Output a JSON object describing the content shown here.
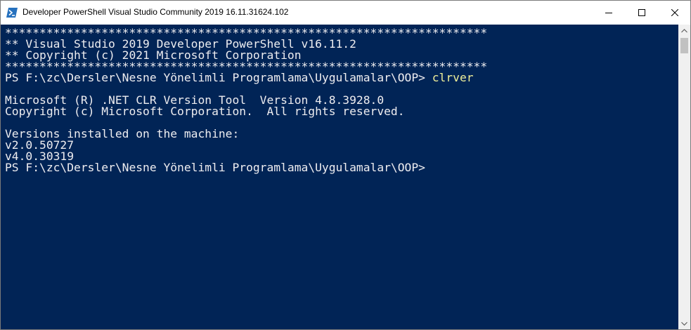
{
  "window": {
    "title": "Developer PowerShell Visual Studio Community 2019 16.11.31624.102",
    "icon": "powershell-icon",
    "buttons": {
      "minimize": "minimize-icon",
      "maximize": "maximize-icon",
      "close": "close-icon"
    }
  },
  "colors": {
    "console_background": "#012456",
    "console_text": "#eeedf0",
    "command_text": "#eeee99"
  },
  "console": {
    "lines": [
      {
        "text": "**********************************************************************"
      },
      {
        "text": "** Visual Studio 2019 Developer PowerShell v16.11.2"
      },
      {
        "text": "** Copyright (c) 2021 Microsoft Corporation"
      },
      {
        "text": "**********************************************************************"
      },
      {
        "prompt": "PS F:\\zc\\Dersler\\Nesne Yönelimli Programlama\\Uygulamalar\\OOP> ",
        "command": "clrver"
      },
      {
        "text": ""
      },
      {
        "text": "Microsoft (R) .NET CLR Version Tool  Version 4.8.3928.0"
      },
      {
        "text": "Copyright (c) Microsoft Corporation.  All rights reserved."
      },
      {
        "text": ""
      },
      {
        "text": "Versions installed on the machine:"
      },
      {
        "text": "v2.0.50727"
      },
      {
        "text": "v4.0.30319"
      },
      {
        "prompt": "PS F:\\zc\\Dersler\\Nesne Yönelimli Programlama\\Uygulamalar\\OOP> ",
        "command": ""
      }
    ]
  }
}
